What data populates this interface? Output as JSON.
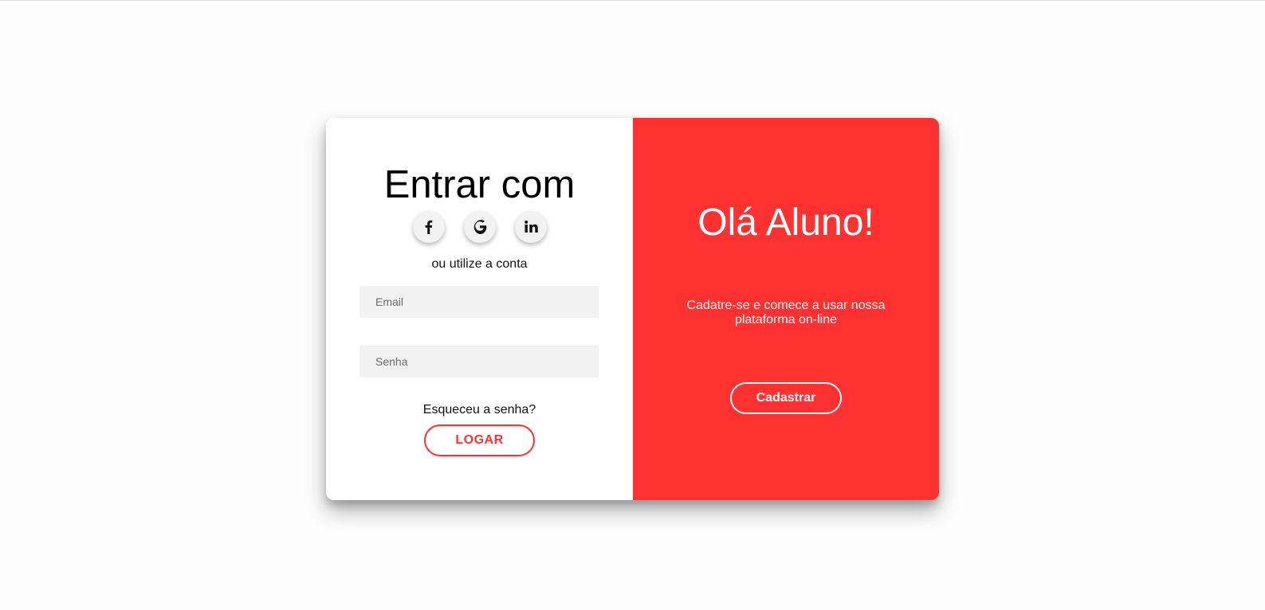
{
  "login": {
    "title": "Entrar com",
    "social_icons": [
      "facebook-icon",
      "google-icon",
      "linkedin-icon"
    ],
    "subtitle": "ou utilize a conta",
    "email_placeholder": "Email",
    "email_value": "",
    "password_placeholder": "Senha",
    "password_value": "",
    "forgot_label": "Esqueceu a senha?",
    "submit_label": "LOGAR"
  },
  "signup": {
    "title": "Olá Aluno!",
    "description": "Cadatre-se e comece a usar nossa plataforma on-line",
    "button_label": "Cadastrar"
  },
  "colors": {
    "accent": "#ff3131",
    "input_background": "#f2f2f2",
    "page_background": "#fdfdfd"
  }
}
